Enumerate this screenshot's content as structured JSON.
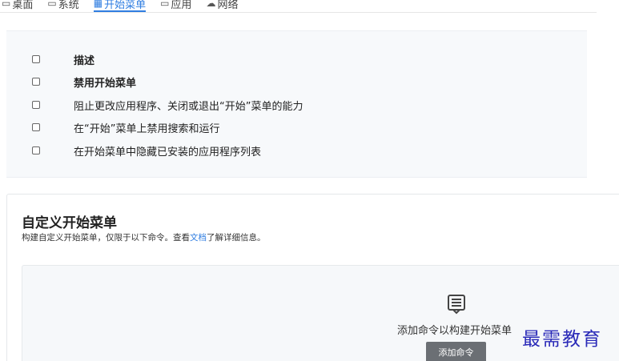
{
  "tabs": [
    {
      "label": "桌面",
      "icon": "desktop-icon",
      "active": false
    },
    {
      "label": "系统",
      "icon": "system-icon",
      "active": false
    },
    {
      "label": "开始菜单",
      "icon": "start-menu-icon",
      "active": true
    },
    {
      "label": "应用",
      "icon": "apps-icon",
      "active": false
    },
    {
      "label": "网络",
      "icon": "cloud-icon",
      "active": false
    }
  ],
  "options": [
    {
      "label": "描述",
      "bold": true,
      "checked": false
    },
    {
      "label": "禁用开始菜单",
      "bold": true,
      "checked": false
    },
    {
      "label": "阻止更改应用程序、关闭或退出“开始”菜单的能力",
      "bold": false,
      "checked": false
    },
    {
      "label": "在“开始”菜单上禁用搜索和运行",
      "bold": false,
      "checked": false
    },
    {
      "label": "在开始菜单中隐藏已安装的应用程序列表",
      "bold": false,
      "checked": false
    }
  ],
  "custom": {
    "title": "自定义开始菜单",
    "desc_before": "构建自定义开始菜单，仅限于以下命令。查看",
    "desc_link": "文档",
    "desc_after": "了解详细信息。",
    "empty_text": "添加命令以构建开始菜单",
    "add_button": "添加命令"
  },
  "watermark": "最需教育",
  "colors": {
    "accent": "#2f7de1",
    "button": "#6b6f74",
    "panel": "#f7f9fb"
  }
}
